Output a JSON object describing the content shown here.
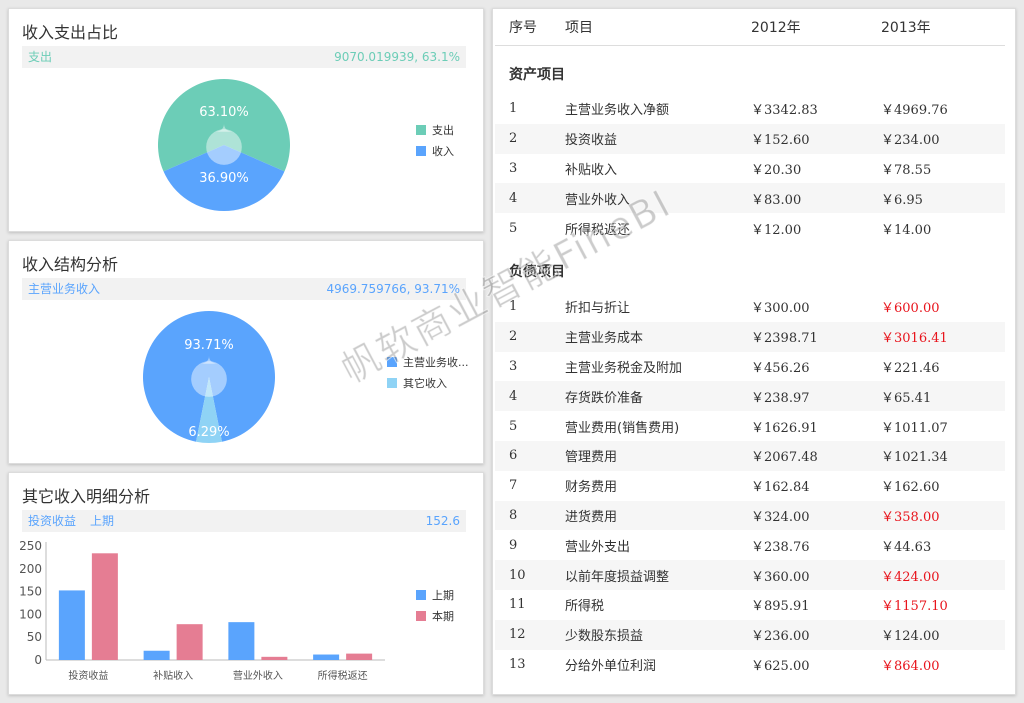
{
  "colors": {
    "teal": "#6ccdb7",
    "blue": "#5aa4fd",
    "pink": "#e57d93",
    "red": "#e8141c"
  },
  "card1": {
    "title": "收入支出占比",
    "info_left": "支出",
    "info_right": "9070.019939, 63.1%",
    "chart_data": {
      "type": "pie",
      "slices": [
        {
          "name": "支出",
          "value": 63.1,
          "label": "63.10%"
        },
        {
          "name": "收入",
          "value": 36.9,
          "label": "36.90%"
        }
      ],
      "legend": [
        "支出",
        "收入"
      ]
    }
  },
  "card2": {
    "title": "收入结构分析",
    "info_left": "主营业务收入",
    "info_right": "4969.759766, 93.71%",
    "chart_data": {
      "type": "pie",
      "slices": [
        {
          "name": "主营业务收入",
          "value": 93.71,
          "label": "93.71%"
        },
        {
          "name": "其它收入",
          "value": 6.29,
          "label": "6.29%"
        }
      ],
      "legend": [
        "主营业务收...",
        "其它收入"
      ]
    }
  },
  "card3": {
    "title": "其它收入明细分析",
    "info_left": "投资收益",
    "info_mid": "上期",
    "info_right": "152.6",
    "chart_data": {
      "type": "bar",
      "categories": [
        "投资收益",
        "补贴收入",
        "营业外收入",
        "所得税返还"
      ],
      "series": [
        {
          "name": "上期",
          "values": [
            152.6,
            20.3,
            83.0,
            12.0
          ]
        },
        {
          "name": "本期",
          "values": [
            234.0,
            78.55,
            6.95,
            14.0
          ]
        }
      ],
      "ylim": [
        0,
        250
      ],
      "yticks": [
        0,
        50,
        100,
        150,
        200,
        250
      ]
    }
  },
  "table": {
    "headers": [
      "序号",
      "项目",
      "2012年",
      "2013年"
    ],
    "section_assets": "资产项目",
    "assets": [
      {
        "no": "1",
        "item": "主营业务收入净额",
        "y2012": "￥3342.83",
        "y2013": "￥4969.76",
        "red": false
      },
      {
        "no": "2",
        "item": "投资收益",
        "y2012": "￥152.60",
        "y2013": "￥234.00",
        "red": false
      },
      {
        "no": "3",
        "item": "补贴收入",
        "y2012": "￥20.30",
        "y2013": "￥78.55",
        "red": false
      },
      {
        "no": "4",
        "item": "营业外收入",
        "y2012": "￥83.00",
        "y2013": "￥6.95",
        "red": false
      },
      {
        "no": "5",
        "item": "所得税返还",
        "y2012": "￥12.00",
        "y2013": "￥14.00",
        "red": false
      }
    ],
    "section_liabilities": "负债项目",
    "liabilities": [
      {
        "no": "1",
        "item": "折扣与折让",
        "y2012": "￥300.00",
        "y2013": "￥600.00",
        "red": true
      },
      {
        "no": "2",
        "item": "主营业务成本",
        "y2012": "￥2398.71",
        "y2013": "￥3016.41",
        "red": true
      },
      {
        "no": "3",
        "item": "主营业务税金及附加",
        "y2012": "￥456.26",
        "y2013": "￥221.46",
        "red": false
      },
      {
        "no": "4",
        "item": "存货跌价准备",
        "y2012": "￥238.97",
        "y2013": "￥65.41",
        "red": false
      },
      {
        "no": "5",
        "item": "营业费用(销售费用)",
        "y2012": "￥1626.91",
        "y2013": "￥1011.07",
        "red": false
      },
      {
        "no": "6",
        "item": "管理费用",
        "y2012": "￥2067.48",
        "y2013": "￥1021.34",
        "red": false
      },
      {
        "no": "7",
        "item": "财务费用",
        "y2012": "￥162.84",
        "y2013": "￥162.60",
        "red": false
      },
      {
        "no": "8",
        "item": "进货费用",
        "y2012": "￥324.00",
        "y2013": "￥358.00",
        "red": true
      },
      {
        "no": "9",
        "item": "营业外支出",
        "y2012": "￥238.76",
        "y2013": "￥44.63",
        "red": false
      },
      {
        "no": "10",
        "item": "以前年度损益调整",
        "y2012": "￥360.00",
        "y2013": "￥424.00",
        "red": true
      },
      {
        "no": "11",
        "item": "所得税",
        "y2012": "￥895.91",
        "y2013": "￥1157.10",
        "red": true
      },
      {
        "no": "12",
        "item": "少数股东损益",
        "y2012": "￥236.00",
        "y2013": "￥124.00",
        "red": false
      },
      {
        "no": "13",
        "item": "分给外单位利润",
        "y2012": "￥625.00",
        "y2013": "￥864.00",
        "red": true
      }
    ]
  },
  "watermark": "帆软商业智能FineBI"
}
